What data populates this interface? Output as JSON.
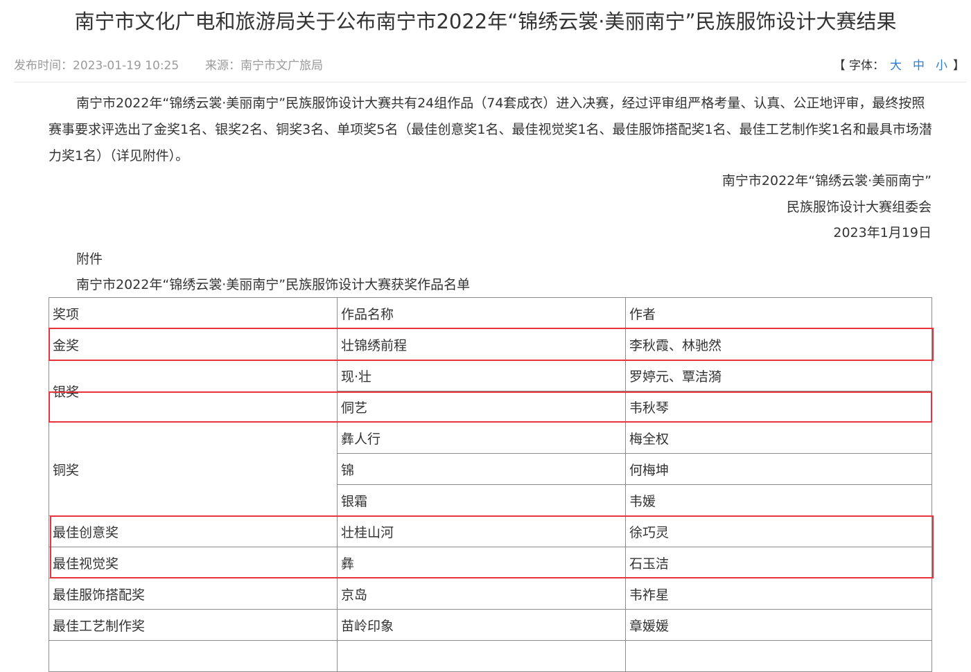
{
  "article": {
    "title": "南宁市文化广电和旅游局关于公布南宁市2022年“锦绣云裳·美丽南宁”民族服饰设计大赛结果",
    "publish_time": "发布时间：2023-01-19 10:25",
    "source": "来源：南宁市文广旅局",
    "font_size": {
      "prefix": "【 字体：",
      "large": "大",
      "medium": "中",
      "small": "小",
      "suffix": "】"
    },
    "body": "南宁市2022年“锦绣云裳·美丽南宁”民族服饰设计大赛共有24组作品（74套成衣）进入决赛，经过评审组严格考量、认真、公正地评审，最终按照赛事要求评选出了金奖1名、银奖2名、铜奖3名、单项奖5名（最佳创意奖1名、最佳视觉奖1名、最佳服饰搭配奖1名、最佳工艺制作奖1名和最具市场潜力奖1名）（详见附件）。",
    "signature": {
      "line1": "南宁市2022年“锦绣云裳·美丽南宁”",
      "line2": "民族服饰设计大赛组委会",
      "date": "2023年1月19日"
    },
    "attachment_label": "附件",
    "attachment_title": "南宁市2022年“锦绣云裳·美丽南宁”民族服饰设计大赛获奖作品名单"
  },
  "table": {
    "headers": [
      "奖项",
      "作品名称",
      "作者"
    ],
    "groups": {
      "gold": {
        "award": "金奖",
        "rows": [
          [
            "壮锦绣前程",
            "李秋霞、林驰然"
          ]
        ]
      },
      "silver": {
        "award": "银奖",
        "rows": [
          [
            "现·壮",
            "罗婷元、覃洁漪"
          ],
          [
            "侗艺",
            "韦秋琴"
          ]
        ]
      },
      "bronze": {
        "award": "铜奖",
        "rows": [
          [
            "彝人行",
            "梅全权"
          ],
          [
            "锦",
            "何梅坤"
          ],
          [
            "银霜",
            "韦媛"
          ]
        ]
      },
      "single": [
        [
          "最佳创意奖",
          "壮桂山河",
          "徐巧灵"
        ],
        [
          "最佳视觉奖",
          "彝",
          "石玉洁"
        ],
        [
          "最佳服饰搭配奖",
          "京岛",
          "韦祚星"
        ],
        [
          "最佳工艺制作奖",
          "苗岭印象",
          "章媛媛"
        ]
      ]
    }
  },
  "colors": {
    "highlight": "#e8323c",
    "link": "#2a7ed3",
    "meta": "#9a9a9a",
    "text": "#333333"
  }
}
